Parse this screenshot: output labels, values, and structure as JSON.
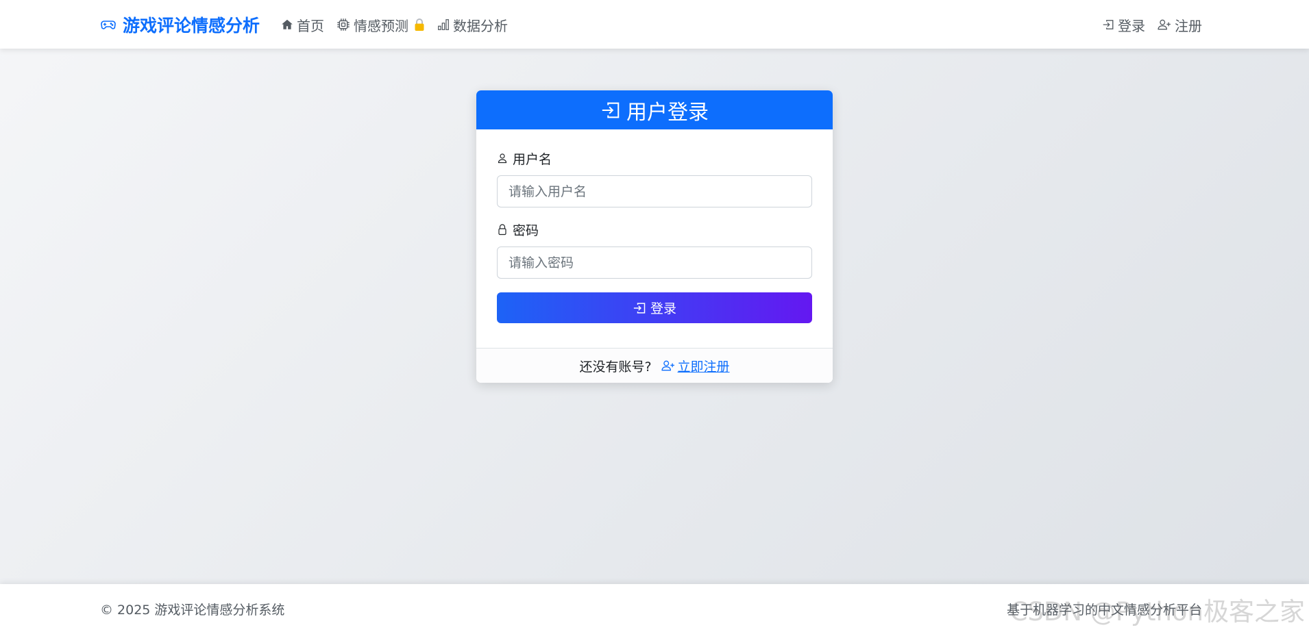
{
  "navbar": {
    "brand": "游戏评论情感分析",
    "links": [
      {
        "label": "首页"
      },
      {
        "label": "情感预测"
      },
      {
        "label": "数据分析"
      }
    ],
    "right_links": [
      {
        "label": "登录"
      },
      {
        "label": "注册"
      }
    ]
  },
  "card": {
    "title": "用户登录",
    "username_label": "用户名",
    "username_placeholder": "请输入用户名",
    "username_value": "",
    "password_label": "密码",
    "password_placeholder": "请输入密码",
    "password_value": "",
    "submit_label": "登录",
    "footer_text": "还没有账号?",
    "register_link": "立即注册"
  },
  "footer": {
    "copyright": "© 2025 游戏评论情感分析系统",
    "slogan": "基于机器学习的中文情感分析平台",
    "watermark": "CSDN @Python极客之家"
  },
  "colors": {
    "primary": "#0d6efd",
    "gradient_start": "#1d63f6",
    "gradient_end": "#6418f1",
    "lock": "#f5b800"
  },
  "icons": {
    "brand": "gamepad-icon",
    "home": "house-icon",
    "predict": "cpu-icon",
    "lock_badge": "padlock-emoji-icon",
    "analysis": "bar-chart-icon",
    "login": "box-arrow-in-right-icon",
    "register": "person-plus-icon",
    "username": "person-icon",
    "password": "lock-icon"
  }
}
